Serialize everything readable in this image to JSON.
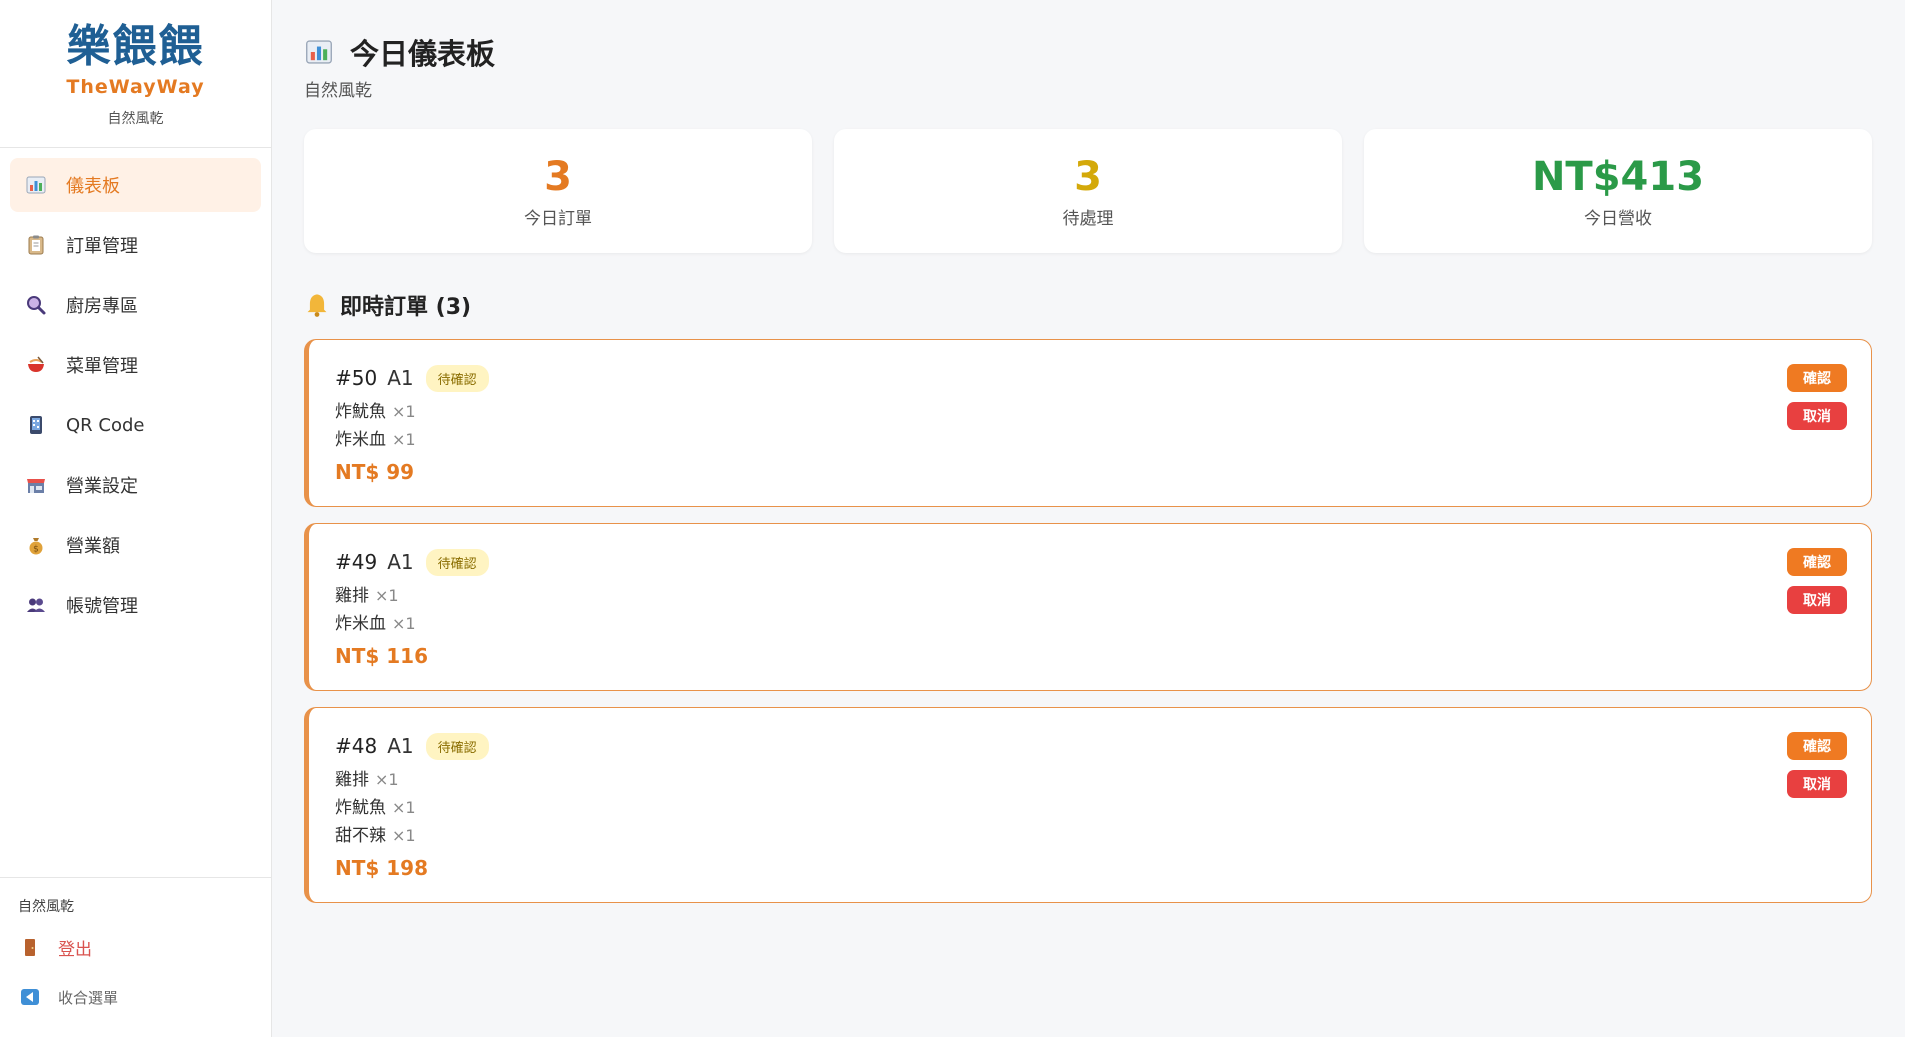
{
  "brand": {
    "logo": "樂餵餵",
    "name": "TheWayWay",
    "store": "自然風乾"
  },
  "nav": [
    {
      "id": "dashboard",
      "label": "儀表板",
      "icon": "bar-chart-icon",
      "active": true
    },
    {
      "id": "orders",
      "label": "訂單管理",
      "icon": "clipboard-icon",
      "active": false
    },
    {
      "id": "kitchen",
      "label": "廚房專區",
      "icon": "magnifier-icon",
      "active": false
    },
    {
      "id": "menu",
      "label": "菜單管理",
      "icon": "bowl-icon",
      "active": false
    },
    {
      "id": "qrcode",
      "label": "QR Code",
      "icon": "qr-code-icon",
      "active": false
    },
    {
      "id": "business",
      "label": "營業設定",
      "icon": "store-icon",
      "active": false
    },
    {
      "id": "revenue",
      "label": "營業額",
      "icon": "money-bag-icon",
      "active": false
    },
    {
      "id": "accounts",
      "label": "帳號管理",
      "icon": "users-icon",
      "active": false
    }
  ],
  "footer": {
    "store": "自然風乾",
    "logout": "登出",
    "collapse": "收合選單"
  },
  "page": {
    "title": "今日儀表板",
    "subtitle": "自然風乾"
  },
  "stats": [
    {
      "value": "3",
      "label": "今日訂單",
      "color": "#e47a22"
    },
    {
      "value": "3",
      "label": "待處理",
      "color": "#d4a90a"
    },
    {
      "value": "NT$413",
      "label": "今日營收",
      "color": "#2b9a48"
    }
  ],
  "live": {
    "title": "即時訂單 (3)"
  },
  "orders": [
    {
      "no": "#50",
      "table": "A1",
      "status": "待確認",
      "items": [
        {
          "name": "炸魷魚",
          "qty": "×1"
        },
        {
          "name": "炸米血",
          "qty": "×1"
        }
      ],
      "total": "NT$ 99"
    },
    {
      "no": "#49",
      "table": "A1",
      "status": "待確認",
      "items": [
        {
          "name": "雞排",
          "qty": "×1"
        },
        {
          "name": "炸米血",
          "qty": "×1"
        }
      ],
      "total": "NT$ 116"
    },
    {
      "no": "#48",
      "table": "A1",
      "status": "待確認",
      "items": [
        {
          "name": "雞排",
          "qty": "×1"
        },
        {
          "name": "炸魷魚",
          "qty": "×1"
        },
        {
          "name": "甜不辣",
          "qty": "×1"
        }
      ],
      "total": "NT$ 198"
    }
  ],
  "buttons": {
    "confirm": "確認",
    "cancel": "取消"
  }
}
